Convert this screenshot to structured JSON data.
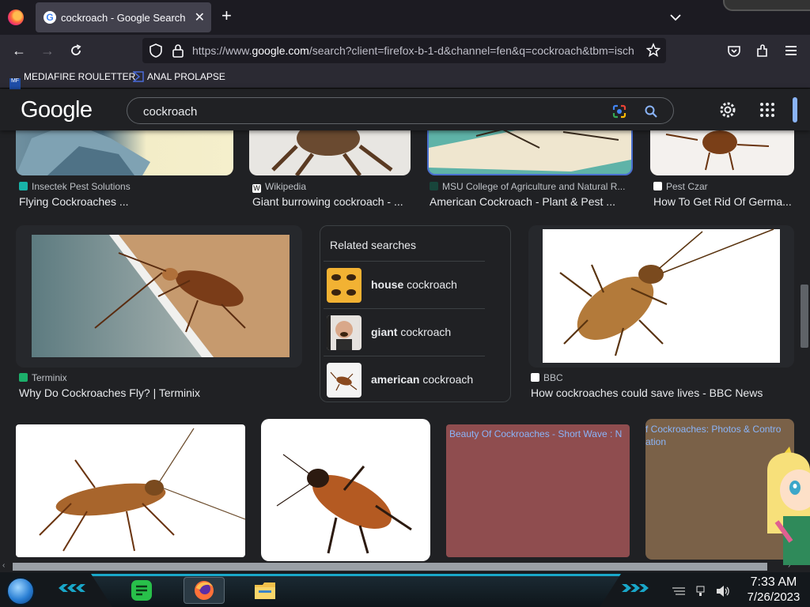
{
  "browser": {
    "tab_title": "cockroach - Google Search",
    "url_prefix": "https://www.",
    "url_domain": "google.com",
    "url_rest": "/search?client=firefox-b-1-d&channel=fen&q=cockroach&tbm=isch",
    "bookmarks": [
      "MEDIAFIRE ROULETTER",
      "ANAL PROLAPSE"
    ]
  },
  "google": {
    "logo": "Google",
    "query": "cockroach"
  },
  "results_top": [
    {
      "source": "Insectek Pest Solutions",
      "caption": "Flying Cockroaches ..."
    },
    {
      "source": "Wikipedia",
      "caption": "Giant burrowing cockroach - ..."
    },
    {
      "source": "MSU College of Agriculture and Natural R...",
      "caption": "American Cockroach - Plant & Pest ..."
    },
    {
      "source": "Pest Czar",
      "caption": "How To Get Rid Of Germa..."
    }
  ],
  "results_mid": [
    {
      "source": "Terminix",
      "caption": "Why Do Cockroaches Fly? | Terminix"
    },
    {
      "source": "BBC",
      "caption": "How cockroaches could save lives - BBC News"
    }
  ],
  "related": {
    "title": "Related searches",
    "items": [
      {
        "bold": "house",
        "rest": " cockroach"
      },
      {
        "bold": "giant",
        "rest": " cockroach"
      },
      {
        "bold": "american",
        "rest": " cockroach"
      }
    ]
  },
  "alt_texts": [
    "Beauty Of Cockroaches - Short Wave : N",
    "f Cockroaches: Photos & Contro",
    "ation"
  ],
  "taskbar": {
    "time": "7:33 AM",
    "date": "7/26/2023"
  },
  "colors": {
    "accent": "#8ab4f8",
    "page_bg": "#202124",
    "cyan_frame": "#19a7c9"
  }
}
